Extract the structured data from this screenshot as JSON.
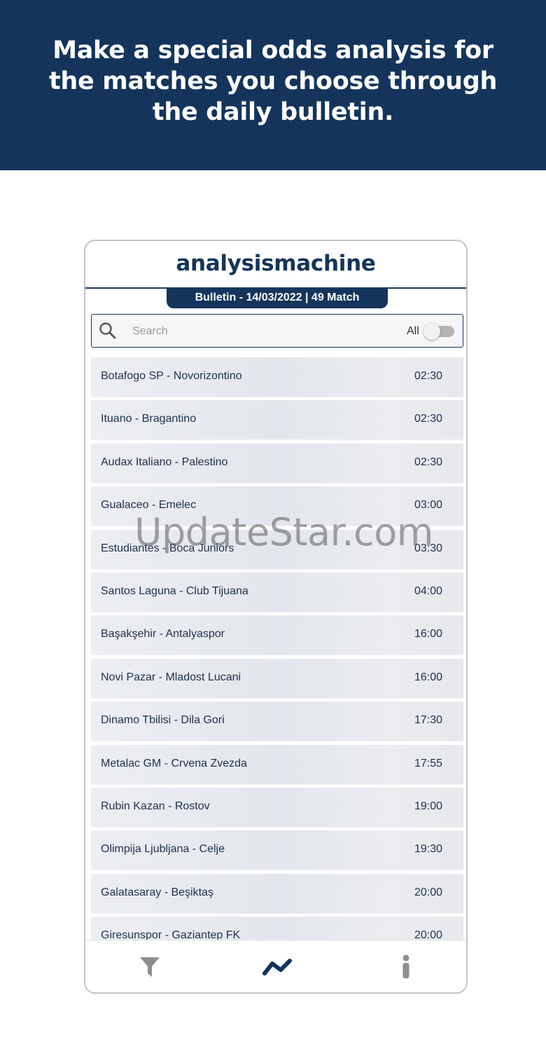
{
  "banner": {
    "text": "Make a special odds analysis for the matches you choose through the daily bulletin."
  },
  "app": {
    "title": "analysismachine",
    "bulletin_label": "Bulletin - 14/03/2022 | 49 Match"
  },
  "search": {
    "placeholder": "Search",
    "value": "",
    "toggle_label": "All",
    "toggle_on": false
  },
  "matches": [
    {
      "name": "Botafogo SP - Novorizontino",
      "time": "02:30"
    },
    {
      "name": "Ituano - Bragantino",
      "time": "02:30"
    },
    {
      "name": "Audax Italiano - Palestino",
      "time": "02:30"
    },
    {
      "name": "Gualaceo - Emelec",
      "time": "03:00"
    },
    {
      "name": "Estudiantes - Boca Juniors",
      "time": "03:30"
    },
    {
      "name": "Santos Laguna - Club Tijuana",
      "time": "04:00"
    },
    {
      "name": "Başakşehir - Antalyaspor",
      "time": "16:00"
    },
    {
      "name": "Novi Pazar - Mladost Lucani",
      "time": "16:00"
    },
    {
      "name": "Dinamo Tbilisi - Dila Gori",
      "time": "17:30"
    },
    {
      "name": "Metalac GM - Crvena Zvezda",
      "time": "17:55"
    },
    {
      "name": "Rubin Kazan - Rostov",
      "time": "19:00"
    },
    {
      "name": "Olimpija Ljubljana - Celje",
      "time": "19:30"
    },
    {
      "name": "Galatasaray - Beşiktaş",
      "time": "20:00"
    },
    {
      "name": "Giresunspor - Gaziantep FK",
      "time": "20:00"
    }
  ],
  "nav": {
    "items": [
      {
        "icon": "filter-icon"
      },
      {
        "icon": "chart-line-icon"
      },
      {
        "icon": "info-icon"
      }
    ]
  },
  "watermark": "UpdateStar.com",
  "colors": {
    "brand": "#14345b",
    "row_bg": "#e6e8ec",
    "icon_gray": "#8e8e8e"
  }
}
